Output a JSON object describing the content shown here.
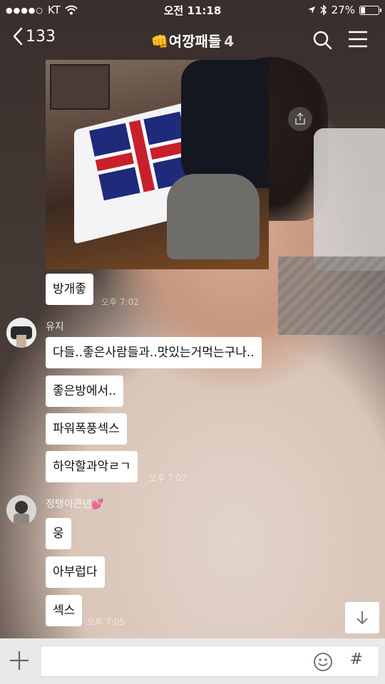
{
  "status_bar": {
    "carrier": "KT",
    "time": "오전 11:18",
    "battery": "27%",
    "battery_level": 0.27
  },
  "nav": {
    "back_count": "133",
    "title": "여깡패들",
    "member_count": "4"
  },
  "messages": [
    {
      "type": "image",
      "time": ""
    },
    {
      "text": "방개좋",
      "time": "오후 7:02"
    },
    {
      "sender": "유지"
    },
    {
      "text": "다들..좋은사람들과..맛있는거먹는구나.."
    },
    {
      "text": "좋은방에서.."
    },
    {
      "text": "파워폭풍섹스"
    },
    {
      "text": "하악할과악ㄹㄱ",
      "time": "오후 7:02"
    },
    {
      "sender": "정탱이큰년💕"
    },
    {
      "text": "웅"
    },
    {
      "text": "아부럽다"
    },
    {
      "text": "섹스",
      "time": "오후 7:05"
    }
  ],
  "input": {
    "placeholder": "",
    "hash_label": "#"
  },
  "icons": {
    "back": "chevron-left-icon",
    "fist_emoji": "👊",
    "search": "search-icon",
    "menu": "hamburger-menu-icon",
    "share": "share-icon",
    "scroll_down": "arrow-down-icon",
    "add": "plus-icon",
    "emoticon": "smiley-icon"
  }
}
